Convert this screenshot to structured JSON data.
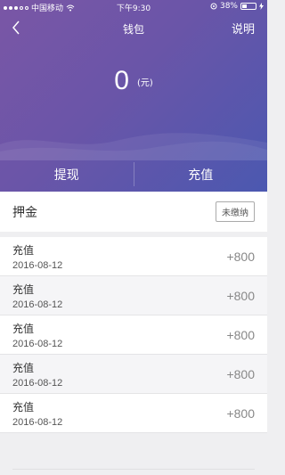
{
  "status_bar": {
    "carrier": "中国移动",
    "time": "下午9:30",
    "battery": "38%"
  },
  "nav": {
    "title": "钱包",
    "help": "说明"
  },
  "balance": {
    "value": "0",
    "unit": "(元)"
  },
  "actions": {
    "withdraw": "提现",
    "recharge": "充值"
  },
  "deposit": {
    "label": "押金",
    "status": "未缴纳"
  },
  "records": [
    {
      "title": "充值",
      "date": "2016-08-12",
      "amount": "+800"
    },
    {
      "title": "充值",
      "date": "2016-08-12",
      "amount": "+800"
    },
    {
      "title": "充值",
      "date": "2016-08-12",
      "amount": "+800"
    },
    {
      "title": "充值",
      "date": "2016-08-12",
      "amount": "+800"
    },
    {
      "title": "充值",
      "date": "2016-08-12",
      "amount": "+800"
    }
  ]
}
